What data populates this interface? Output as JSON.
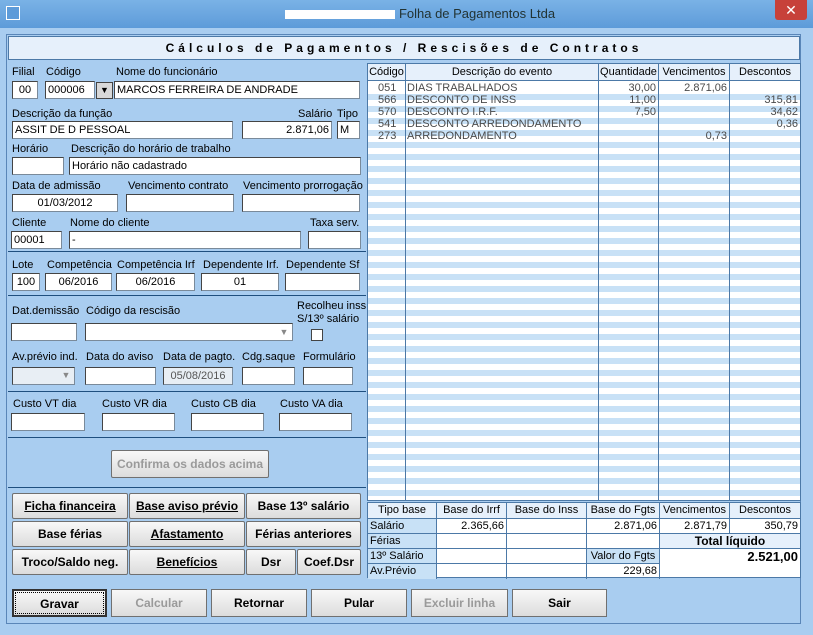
{
  "window": {
    "title": "Folha de Pagamentos Ltda",
    "close_glyph": "✕"
  },
  "header": {
    "title": "Cálculos de Pagamentos  /  Rescisões de Contratos"
  },
  "employee": {
    "filial_label": "Filial",
    "filial": "00",
    "codigo_label": "Código",
    "codigo": "000006",
    "nome_label": "Nome do funcionário",
    "nome": "MARCOS FERREIRA DE ANDRADE",
    "funcao_label": "Descrição da função",
    "funcao": "ASSIT DE D PESSOAL",
    "salario_label": "Salário",
    "salario": "2.871,06",
    "tipo_label": "Tipo",
    "tipo": "M",
    "horario_label": "Horário",
    "horario": "",
    "desc_horario_label": "Descrição do horário de trabalho",
    "desc_horario": "Horário não cadastrado",
    "admissao_label": "Data de admissão",
    "admissao": "01/03/2012",
    "venc_contrato_label": "Vencimento contrato",
    "venc_contrato": "",
    "venc_prorrog_label": "Vencimento prorrogação",
    "venc_prorrog": "",
    "cliente_label": "Cliente",
    "cliente": "00001",
    "nome_cliente_label": "Nome do cliente",
    "nome_cliente": "-",
    "taxa_label": "Taxa serv.",
    "taxa": ""
  },
  "competencia": {
    "lote_label": "Lote",
    "lote": "100",
    "comp_label": "Competência",
    "comp": "06/2016",
    "comp_irf_label": "Competência Irf",
    "comp_irf": "06/2016",
    "dep_irf_label": "Dependente Irf.",
    "dep_irf": "01",
    "dep_sf_label": "Dependente Sf",
    "dep_sf": ""
  },
  "rescisao": {
    "demissao_label": "Dat.demissão",
    "demissao": "",
    "codigo_label": "Código da rescisão",
    "codigo": "",
    "recolheu_label1": "Recolheu inss",
    "recolheu_label2": "S/13º salário",
    "aviso_ind_label": "Av.prévio ind.",
    "aviso_ind": "",
    "data_aviso_label": "Data do aviso",
    "data_aviso": "",
    "data_pagto_label": "Data de pagto.",
    "data_pagto": "05/08/2016",
    "cdg_saque_label": "Cdg.saque",
    "cdg_saque": "",
    "formulario_label": "Formulário",
    "formulario": ""
  },
  "custos": {
    "vt_label": "Custo VT dia",
    "vr_label": "Custo VR  dia",
    "cb_label": "Custo CB dia",
    "va_label": "Custo VA  dia"
  },
  "confirm_label": "Confirma os dados acima",
  "side_buttons": [
    "Ficha financeira",
    "Base aviso prévio",
    "Base 13º salário",
    "Base férias",
    "Afastamento",
    "Férias anteriores",
    "Troco/Saldo neg.",
    "Benefícios",
    "Dsr",
    "Coef.Dsr"
  ],
  "events": {
    "headers": [
      "Código",
      "Descrição do evento",
      "Quantidade",
      "Vencimentos",
      "Descontos"
    ],
    "rows": [
      {
        "codigo": "051",
        "descricao": "DIAS TRABALHADOS",
        "qtd": "30,00",
        "venc": "2.871,06",
        "desc": ""
      },
      {
        "codigo": "566",
        "descricao": "DESCONTO DE INSS",
        "qtd": "11,00",
        "venc": "",
        "desc": "315,81"
      },
      {
        "codigo": "570",
        "descricao": "DESCONTO I.R.F.",
        "qtd": "7,50",
        "venc": "",
        "desc": "34,62"
      },
      {
        "codigo": "541",
        "descricao": "DESCONTO ARREDONDAMENTO",
        "qtd": "",
        "venc": "",
        "desc": "0,36"
      },
      {
        "codigo": "273",
        "descricao": "ARREDONDAMENTO",
        "qtd": "",
        "venc": "0,73",
        "desc": ""
      }
    ]
  },
  "totals": {
    "headers": [
      "Tipo base",
      "Base do Irrf",
      "Base do Inss",
      "Base do Fgts",
      "Vencimentos",
      "Descontos"
    ],
    "row_labels": [
      "Salário",
      "Férias",
      "13º Salário",
      "Av.Prévio"
    ],
    "salario_irrf": "2.365,66",
    "salario_fgts": "2.871,06",
    "salario_venc": "2.871,79",
    "salario_desc": "350,79",
    "total_liquido_label": "Total líquido",
    "total_liquido": "2.521,00",
    "valor_fgts_label": "Valor do Fgts",
    "valor_fgts": "229,68"
  },
  "bottom_buttons": [
    "Gravar",
    "Calcular",
    "Retornar",
    "Pular",
    "Excluir linha",
    "Sair"
  ]
}
